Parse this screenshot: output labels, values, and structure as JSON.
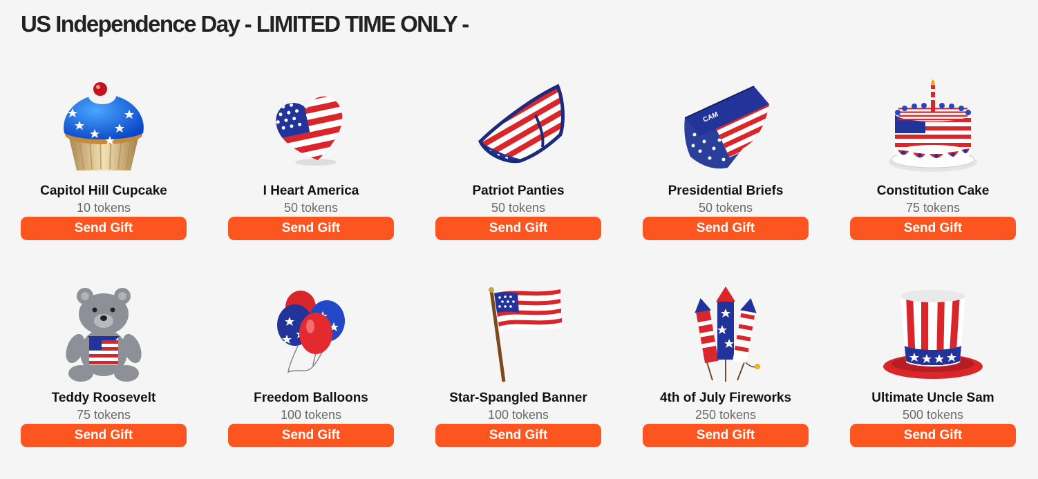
{
  "page": {
    "title": "US Independence Day - LIMITED TIME ONLY -"
  },
  "colors": {
    "accent": "#fd5520",
    "background": "#f5f5f5",
    "flag_red": "#d8262b",
    "flag_blue": "#2a3f9a",
    "flag_white": "#ffffff"
  },
  "gifts": [
    {
      "name": "Capitol Hill Cupcake",
      "price": "10 tokens",
      "button": "Send Gift",
      "icon": "cupcake-icon"
    },
    {
      "name": "I Heart America",
      "price": "50 tokens",
      "button": "Send Gift",
      "icon": "heart-icon"
    },
    {
      "name": "Patriot Panties",
      "price": "50 tokens",
      "button": "Send Gift",
      "icon": "panties-icon"
    },
    {
      "name": "Presidential Briefs",
      "price": "50 tokens",
      "button": "Send Gift",
      "icon": "briefs-icon"
    },
    {
      "name": "Constitution Cake",
      "price": "75 tokens",
      "button": "Send Gift",
      "icon": "cake-icon"
    },
    {
      "name": "Teddy Roosevelt",
      "price": "75 tokens",
      "button": "Send Gift",
      "icon": "teddy-bear-icon"
    },
    {
      "name": "Freedom Balloons",
      "price": "100 tokens",
      "button": "Send Gift",
      "icon": "balloons-icon"
    },
    {
      "name": "Star-Spangled Banner",
      "price": "100 tokens",
      "button": "Send Gift",
      "icon": "flag-icon"
    },
    {
      "name": "4th of July Fireworks",
      "price": "250 tokens",
      "button": "Send Gift",
      "icon": "fireworks-icon"
    },
    {
      "name": "Ultimate Uncle Sam",
      "price": "500 tokens",
      "button": "Send Gift",
      "icon": "top-hat-icon"
    }
  ]
}
